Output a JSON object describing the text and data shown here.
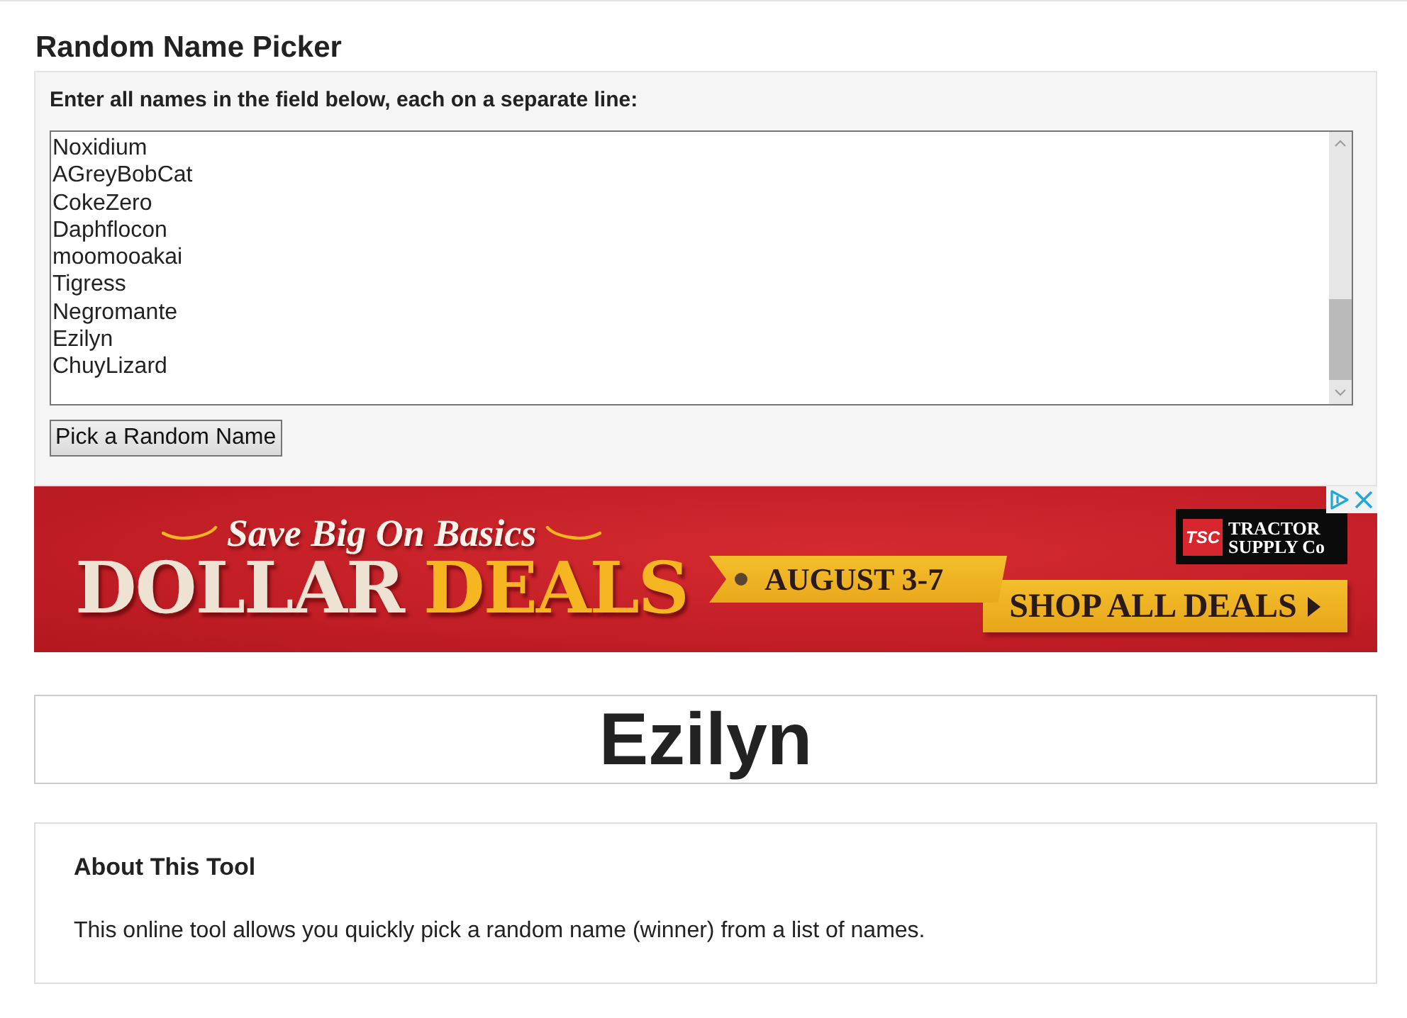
{
  "page": {
    "title": "Random Name Picker"
  },
  "picker": {
    "label": "Enter all names in the field below, each on a separate line:",
    "names": [
      "Noxidium",
      "AGreyBobCat",
      "CokeZero",
      "Daphflocon",
      "moomooakai",
      "Tigress",
      "Negromante",
      "Ezilyn",
      "ChuyLizard"
    ],
    "button": "Pick a Random Name"
  },
  "ad": {
    "tagline": "Save Big On Basics",
    "headline": [
      "DOLLAR",
      "DEALS"
    ],
    "date": "AUGUST 3-7",
    "cta": "SHOP ALL DEALS",
    "logo_mark": "TSC",
    "logo_text": "TRACTOR SUPPLY Co"
  },
  "result": {
    "name": "Ezilyn"
  },
  "about": {
    "title": "About This Tool",
    "text": "This online tool allows you quickly pick a random name (winner) from a list of names."
  }
}
